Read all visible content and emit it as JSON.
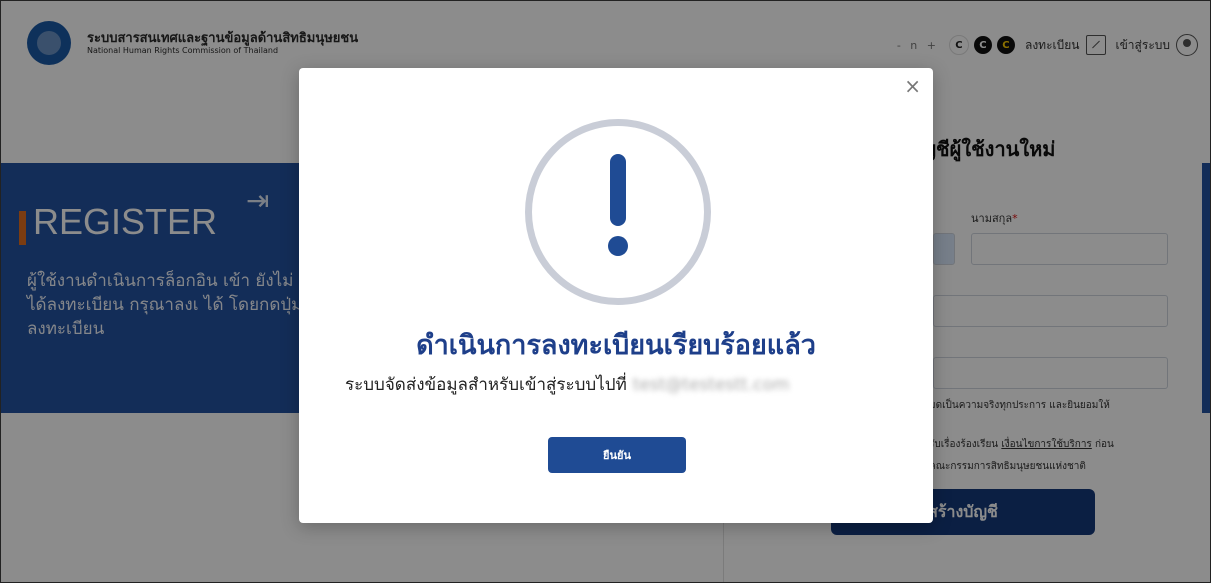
{
  "header": {
    "org_name_th": "ระบบสารสนเทศและฐานข้อมูลด้านสิทธิมนุษยชน",
    "org_name_en": "National Human Rights Commission of Thailand",
    "font_size_controls": "- n +",
    "contrast_options": [
      "C",
      "C",
      "C"
    ],
    "register_link": "ลงทะเบียน",
    "login_link": "เข้าสู่ระบบ"
  },
  "background": {
    "register_title": "REGISTER",
    "register_desc": "ผู้ใช้งานดำเนินการล็อกอิน เข้า ยังไม่ได้ลงทะเบียน กรุณาลงเ ได้ โดยกดปุ่ม ลงทะเบียน",
    "form_heading": "ญชีผู้ใช้งานใหม่",
    "lastname_label": "นามสกุล",
    "lastname_required_mark": "*",
    "consent_text_1": "มดเป็นความจริงทุกประการ และยินยอมให้",
    "consent_text_2_prefix": "รับเรื่องร้องเรียน ",
    "consent_text_2_link": "เงื่อนไขการใช้บริการ",
    "consent_text_2_suffix": " ก่อน",
    "consent_text_3": "คณะกรรมการสิทธิมนุษยชนแห่งชาติ",
    "create_account_button": "สร้างบัญชี"
  },
  "modal": {
    "close_symbol": "×",
    "title": "ดำเนินการลงทะเบียนเรียบร้อยแล้ว",
    "message": "ระบบจัดส่งข้อมูลสำหรับเข้าสู่ระบบไปที่",
    "email": "test@testestt.com",
    "confirm_button": "ยืนยัน"
  },
  "colors": {
    "brand_blue": "#1f4b94",
    "panel_blue": "#2453a0",
    "accent_orange": "#e06d1f",
    "ring_gray": "#c9cdd7"
  }
}
